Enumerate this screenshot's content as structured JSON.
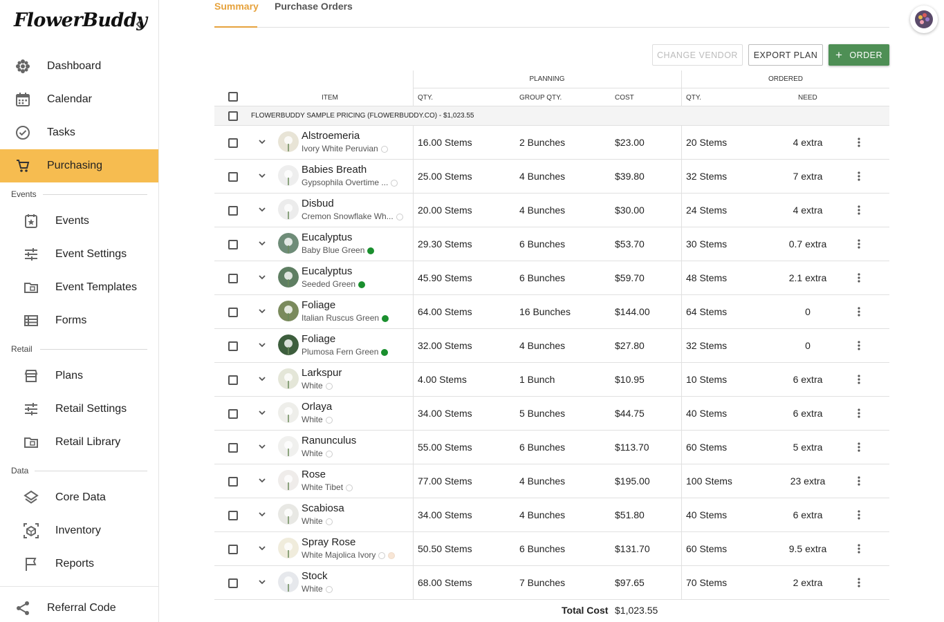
{
  "app": {
    "logo": "FlowerBuddy"
  },
  "sidebar": {
    "main": [
      {
        "label": "Dashboard",
        "icon": "flower-icon"
      },
      {
        "label": "Calendar",
        "icon": "calendar-icon"
      },
      {
        "label": "Tasks",
        "icon": "check-circle-icon"
      },
      {
        "label": "Purchasing",
        "icon": "cart-icon",
        "active": true
      }
    ],
    "sections": [
      {
        "title": "Events",
        "items": [
          {
            "label": "Events",
            "icon": "event-icon"
          },
          {
            "label": "Event Settings",
            "icon": "sliders-icon"
          },
          {
            "label": "Event Templates",
            "icon": "folder-icon"
          },
          {
            "label": "Forms",
            "icon": "list-icon"
          }
        ]
      },
      {
        "title": "Retail",
        "items": [
          {
            "label": "Plans",
            "icon": "store-icon"
          },
          {
            "label": "Retail Settings",
            "icon": "sliders-icon"
          },
          {
            "label": "Retail Library",
            "icon": "folder-icon"
          }
        ]
      },
      {
        "title": "Data",
        "items": [
          {
            "label": "Core Data",
            "icon": "layers-icon"
          },
          {
            "label": "Inventory",
            "icon": "box-icon"
          },
          {
            "label": "Reports",
            "icon": "flag-icon"
          }
        ]
      }
    ],
    "referral": {
      "label": "Referral Code",
      "icon": "share-icon"
    }
  },
  "tabs": [
    {
      "label": "Summary",
      "active": true
    },
    {
      "label": "Purchase Orders",
      "active": false
    }
  ],
  "toolbar": {
    "change_vendor": "CHANGE VENDOR",
    "export_plan": "EXPORT PLAN",
    "order": "ORDER"
  },
  "table": {
    "groups": {
      "planning": "PLANNING",
      "ordered": "ORDERED"
    },
    "columns": {
      "item": "ITEM",
      "qty": "QTY.",
      "group_qty": "GROUP QTY.",
      "cost": "COST",
      "ordered_qty": "QTY.",
      "need": "NEED"
    },
    "vendor": "FLOWERBUDDY SAMPLE PRICING (FLOWERBUDDY.CO) - $1,023.55",
    "rows": [
      {
        "name": "Alstroemeria",
        "variety": "Ivory White Peruvian",
        "dots": [
          "empty"
        ],
        "qty": "16.00 Stems",
        "group_qty": "2 Bunches",
        "cost": "$23.00",
        "ordered": "20 Stems",
        "need": "4 extra"
      },
      {
        "name": "Babies Breath",
        "variety": "Gypsophila Overtime ...",
        "dots": [
          "empty"
        ],
        "qty": "25.00 Stems",
        "group_qty": "4 Bunches",
        "cost": "$39.80",
        "ordered": "32 Stems",
        "need": "7 extra"
      },
      {
        "name": "Disbud",
        "variety": "Cremon Snowflake Wh...",
        "dots": [
          "empty"
        ],
        "qty": "20.00 Stems",
        "group_qty": "4 Bunches",
        "cost": "$30.00",
        "ordered": "24 Stems",
        "need": "4 extra"
      },
      {
        "name": "Eucalyptus",
        "variety": "Baby Blue Green",
        "dots": [
          "green"
        ],
        "qty": "29.30 Stems",
        "group_qty": "6 Bunches",
        "cost": "$53.70",
        "ordered": "30 Stems",
        "need": "0.7 extra"
      },
      {
        "name": "Eucalyptus",
        "variety": "Seeded Green",
        "dots": [
          "green"
        ],
        "qty": "45.90 Stems",
        "group_qty": "6 Bunches",
        "cost": "$59.70",
        "ordered": "48 Stems",
        "need": "2.1 extra"
      },
      {
        "name": "Foliage",
        "variety": "Italian Ruscus Green",
        "dots": [
          "green"
        ],
        "qty": "64.00 Stems",
        "group_qty": "16 Bunches",
        "cost": "$144.00",
        "ordered": "64 Stems",
        "need": "0"
      },
      {
        "name": "Foliage",
        "variety": "Plumosa Fern Green",
        "dots": [
          "green"
        ],
        "qty": "32.00 Stems",
        "group_qty": "4 Bunches",
        "cost": "$27.80",
        "ordered": "32 Stems",
        "need": "0"
      },
      {
        "name": "Larkspur",
        "variety": "White",
        "dots": [
          "empty"
        ],
        "qty": "4.00 Stems",
        "group_qty": "1 Bunch",
        "cost": "$10.95",
        "ordered": "10 Stems",
        "need": "6 extra"
      },
      {
        "name": "Orlaya",
        "variety": "White",
        "dots": [
          "empty"
        ],
        "qty": "34.00 Stems",
        "group_qty": "5 Bunches",
        "cost": "$44.75",
        "ordered": "40 Stems",
        "need": "6 extra"
      },
      {
        "name": "Ranunculus",
        "variety": "White",
        "dots": [
          "empty"
        ],
        "qty": "55.00 Stems",
        "group_qty": "6 Bunches",
        "cost": "$113.70",
        "ordered": "60 Stems",
        "need": "5 extra"
      },
      {
        "name": "Rose",
        "variety": "White Tibet",
        "dots": [
          "empty"
        ],
        "qty": "77.00 Stems",
        "group_qty": "4 Bunches",
        "cost": "$195.00",
        "ordered": "100 Stems",
        "need": "23 extra"
      },
      {
        "name": "Scabiosa",
        "variety": "White",
        "dots": [
          "empty"
        ],
        "qty": "34.00 Stems",
        "group_qty": "4 Bunches",
        "cost": "$51.80",
        "ordered": "40 Stems",
        "need": "6 extra"
      },
      {
        "name": "Spray Rose",
        "variety": "White Majolica Ivory",
        "dots": [
          "empty",
          "cream"
        ],
        "qty": "50.50 Stems",
        "group_qty": "6 Bunches",
        "cost": "$131.70",
        "ordered": "60 Stems",
        "need": "9.5 extra"
      },
      {
        "name": "Stock",
        "variety": "White",
        "dots": [
          "empty"
        ],
        "qty": "68.00 Stems",
        "group_qty": "7 Bunches",
        "cost": "$97.65",
        "ordered": "70 Stems",
        "need": "2 extra"
      }
    ],
    "total_label": "Total Cost",
    "total_value": "$1,023.55"
  },
  "colors": {
    "accent": "#f6bc50",
    "tab_active": "#e6a23c",
    "primary_button": "#4e8f55",
    "dot_green": "#1a8f2e"
  }
}
